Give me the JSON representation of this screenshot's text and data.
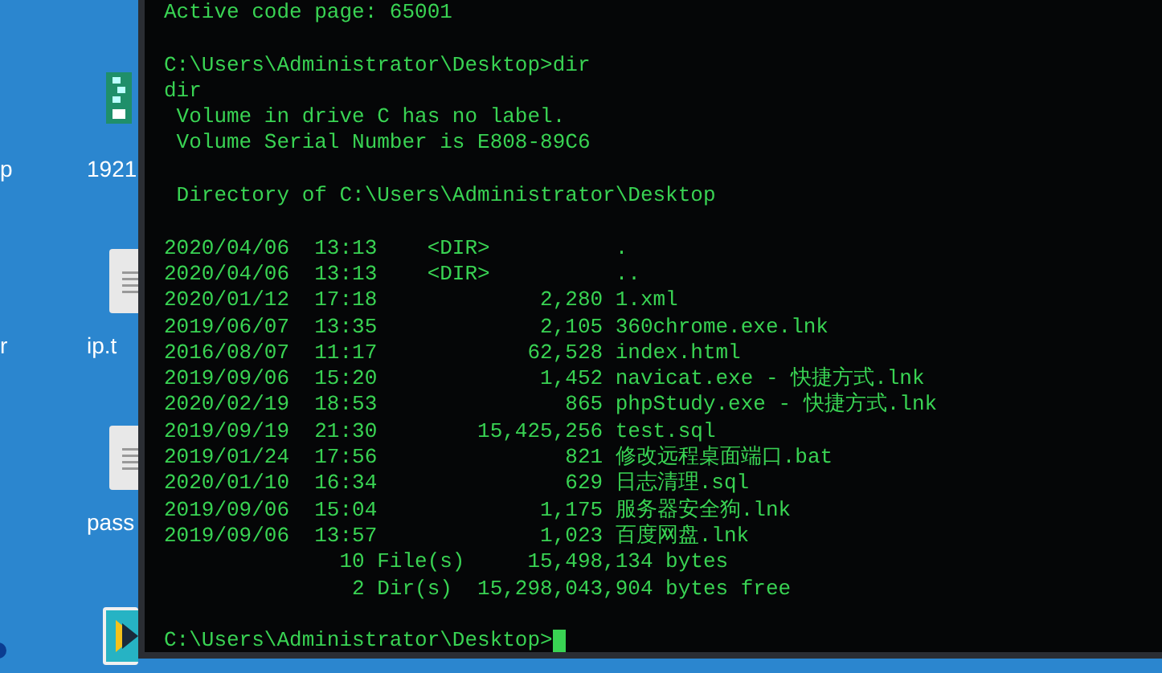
{
  "desktop": {
    "partial_labels": [
      "p",
      "r"
    ],
    "icons": [
      {
        "kind": "app",
        "label": "1921"
      },
      {
        "kind": "doc",
        "label": "ip.t"
      },
      {
        "kind": "doc",
        "label": "pass"
      },
      {
        "kind": "installer"
      }
    ]
  },
  "terminal": {
    "lines": [
      {
        "kind": "text",
        "text": "Active code page: 65001"
      },
      {
        "kind": "blank"
      },
      {
        "kind": "text",
        "text": "C:\\Users\\Administrator\\Desktop>dir"
      },
      {
        "kind": "text",
        "text": "dir"
      },
      {
        "kind": "text",
        "text": " Volume in drive C has no label."
      },
      {
        "kind": "text",
        "text": " Volume Serial Number is E808-89C6"
      },
      {
        "kind": "blank"
      },
      {
        "kind": "text",
        "text": " Directory of C:\\Users\\Administrator\\Desktop"
      },
      {
        "kind": "blank"
      },
      {
        "kind": "text",
        "text": "2020/04/06  13:13    <DIR>          ."
      },
      {
        "kind": "text",
        "text": "2020/04/06  13:13    <DIR>          .."
      },
      {
        "kind": "text",
        "text": "2020/01/12  17:18             2,280 1.xml"
      },
      {
        "kind": "text",
        "text": "2019/06/07  13:35             2,105 360chrome.exe.lnk"
      },
      {
        "kind": "text",
        "text": "2016/08/07  11:17            62,528 index.html"
      },
      {
        "kind": "text",
        "text": "2019/09/06  15:20             1,452 navicat.exe - 快捷方式.lnk"
      },
      {
        "kind": "text",
        "text": "2020/02/19  18:53               865 phpStudy.exe - 快捷方式.lnk"
      },
      {
        "kind": "text",
        "text": "2019/09/19  21:30        15,425,256 test.sql"
      },
      {
        "kind": "text",
        "text": "2019/01/24  17:56               821 修改远程桌面端口.bat"
      },
      {
        "kind": "text",
        "text": "2020/01/10  16:34               629 日志清理.sql"
      },
      {
        "kind": "text",
        "text": "2019/09/06  15:04             1,175 服务器安全狗.lnk"
      },
      {
        "kind": "text",
        "text": "2019/09/06  13:57             1,023 百度网盘.lnk"
      },
      {
        "kind": "text",
        "text": "              10 File(s)     15,498,134 bytes"
      },
      {
        "kind": "text",
        "text": "               2 Dir(s)  15,298,043,904 bytes free"
      },
      {
        "kind": "blank"
      },
      {
        "kind": "prompt",
        "text": "C:\\Users\\Administrator\\Desktop>"
      }
    ]
  }
}
